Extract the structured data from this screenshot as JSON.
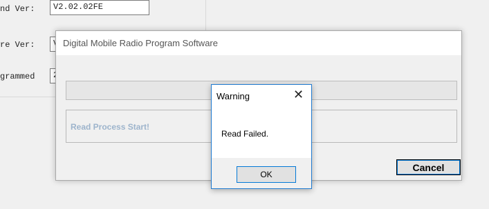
{
  "background": {
    "fields": [
      {
        "label": "nd Ver:",
        "value": "V2.02.02FE"
      },
      {
        "label": "re Ver:",
        "value": "V"
      },
      {
        "label": "grammed",
        "value": "2"
      }
    ]
  },
  "main_dialog": {
    "title": "Digital Mobile Radio Program Software",
    "progress_percent": 0,
    "status_text": "Read Process Start!",
    "cancel_label": "Cancel"
  },
  "warning_dialog": {
    "title": "Warning",
    "close_glyph": "✕",
    "message": "Read Failed.",
    "ok_label": "OK"
  },
  "colors": {
    "accent": "#0078d7",
    "status_text": "#9db4cc"
  }
}
